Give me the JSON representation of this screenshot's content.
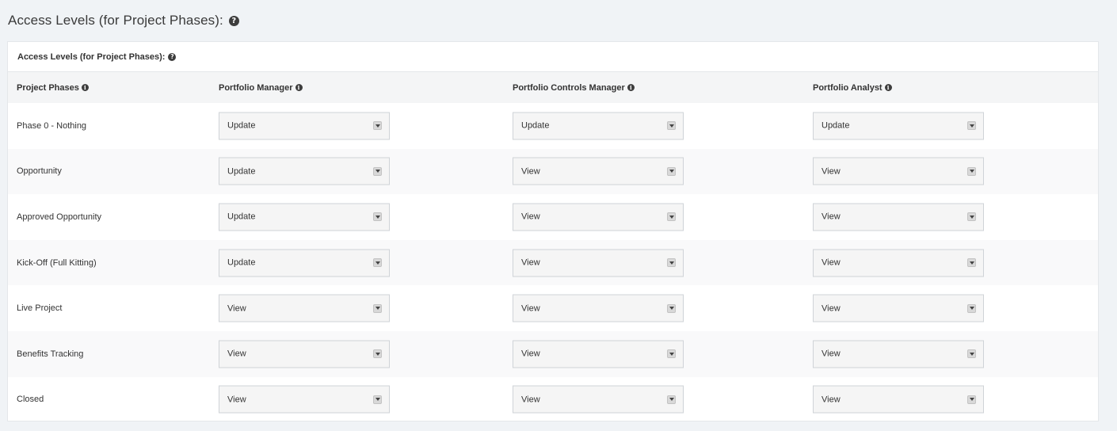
{
  "page": {
    "title": "Access Levels (for Project Phases):",
    "help_icon": "question-circle-icon"
  },
  "panel": {
    "title": "Access Levels (for Project Phases):",
    "help_icon": "question-circle-icon"
  },
  "table": {
    "headers": [
      {
        "label": "Project Phases",
        "icon": "info-circle-icon"
      },
      {
        "label": "Portfolio Manager",
        "icon": "info-circle-icon"
      },
      {
        "label": "Portfolio Controls Manager",
        "icon": "info-circle-icon"
      },
      {
        "label": "Portfolio Analyst",
        "icon": "info-circle-icon"
      }
    ],
    "rows": [
      {
        "phase": "Phase 0 - Nothing",
        "values": [
          "Update",
          "Update",
          "Update"
        ]
      },
      {
        "phase": "Opportunity",
        "values": [
          "Update",
          "View",
          "View"
        ]
      },
      {
        "phase": "Approved Opportunity",
        "values": [
          "Update",
          "View",
          "View"
        ]
      },
      {
        "phase": "Kick-Off (Full Kitting)",
        "values": [
          "Update",
          "View",
          "View"
        ]
      },
      {
        "phase": "Live Project",
        "values": [
          "View",
          "View",
          "View"
        ]
      },
      {
        "phase": "Benefits Tracking",
        "values": [
          "View",
          "View",
          "View"
        ]
      },
      {
        "phase": "Closed",
        "values": [
          "View",
          "View",
          "View"
        ]
      }
    ]
  },
  "colors": {
    "background": "#f0f3f6",
    "panel": "#ffffff",
    "header_row": "#f4f5f6",
    "alt_row": "#f9f9fa",
    "select_bg": "#f5f5f5"
  }
}
